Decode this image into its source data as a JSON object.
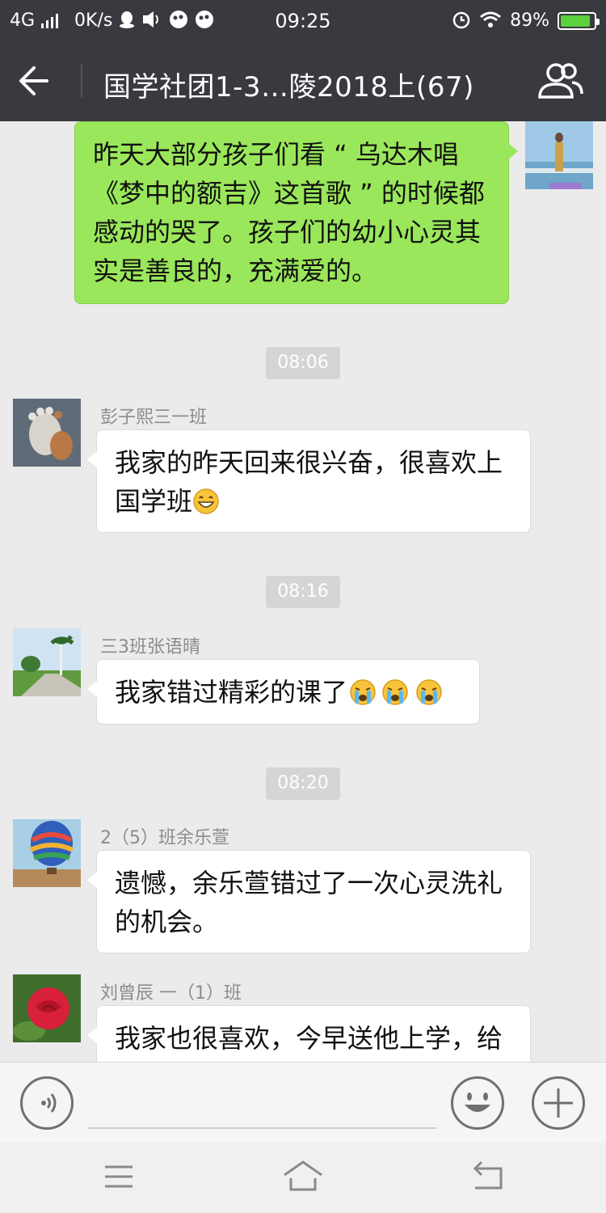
{
  "status_bar": {
    "network": "4G",
    "speed": "0K/s",
    "time": "09:25",
    "battery": "89%",
    "battery_level": 0.89
  },
  "header": {
    "title": "国学社团1-3…陵2018上(67)"
  },
  "messages": [
    {
      "type": "outgoing",
      "text": "昨天大部分孩子们看 “ 乌达木唱《梦中的额吉》这首歌 ” 的时候都感动的哭了。孩子们的幼小心灵其实是善良的，充满爱的。"
    },
    {
      "type": "time",
      "text": "08:06"
    },
    {
      "type": "incoming",
      "sender": "彭子熙三一班",
      "text": "我家的昨天回来很兴奋，很喜欢上国学班",
      "emoji": [
        "grinning"
      ]
    },
    {
      "type": "time",
      "text": "08:16"
    },
    {
      "type": "incoming",
      "sender": "三3班张语晴",
      "text": "我家错过精彩的课了",
      "emoji": [
        "crying",
        "crying",
        "crying"
      ]
    },
    {
      "type": "time",
      "text": "08:20"
    },
    {
      "type": "incoming",
      "sender": "2（5）班余乐萱",
      "text": "遗憾，余乐萱错过了一次心灵洗礼的机会。"
    },
    {
      "type": "incoming",
      "sender": "刘曾辰 一（1）班",
      "text": "我家也很喜欢，今早送他上学，给"
    }
  ],
  "icons": {
    "back": "back-arrow-icon",
    "members": "group-members-icon",
    "voice": "voice-icon",
    "emoji": "emoji-icon",
    "plus": "plus-icon",
    "menu": "menu-icon",
    "home": "home-icon",
    "return": "return-icon"
  },
  "colors": {
    "header_bg": "#393a3f",
    "chat_bg": "#ebebeb",
    "outgoing_bubble": "#9ae75b",
    "incoming_bubble": "#ffffff",
    "sender_name": "#8c8c8c"
  }
}
